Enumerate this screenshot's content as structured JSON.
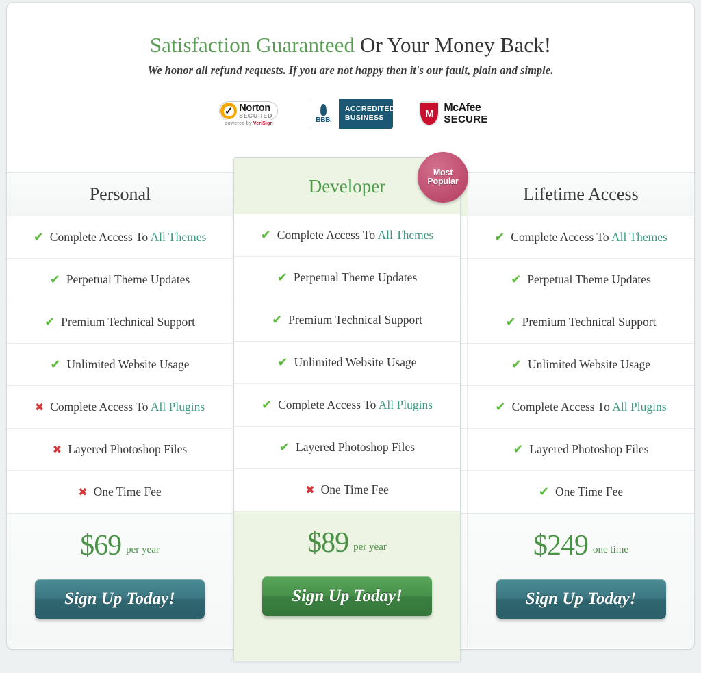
{
  "guarantee": {
    "headline_highlight": "Satisfaction Guaranteed",
    "headline_rest": " Or Your Money Back!",
    "subtext": "We honor all refund requests. If you are not happy then it's our fault, plain and simple."
  },
  "badges": {
    "norton": {
      "icon": "check-badge-icon",
      "line1": "Norton",
      "line2": "SECURED",
      "line3_pre": "powered by ",
      "line3_brand": "VeriSign"
    },
    "bbb": {
      "icon": "bbb-torch-icon",
      "mark": "BBB.",
      "line1": "ACCREDITED",
      "line2": "BUSINESS"
    },
    "mcafee": {
      "icon": "shield-icon",
      "shield_letter": "M",
      "line1": "McAfee",
      "line2": "SECURE"
    }
  },
  "ribbon": {
    "line1": "Most",
    "line2": "Popular"
  },
  "feature_labels": [
    {
      "text": "Complete Access To ",
      "link": "All Themes"
    },
    {
      "text": "Perpetual Theme Updates",
      "link": ""
    },
    {
      "text": "Premium Technical Support",
      "link": ""
    },
    {
      "text": "Unlimited Website Usage",
      "link": ""
    },
    {
      "text": "Complete Access To ",
      "link": "All Plugins"
    },
    {
      "text": "Layered Photoshop Files",
      "link": ""
    },
    {
      "text": "One Time Fee",
      "link": ""
    }
  ],
  "marks": {
    "yes": "✔",
    "no": "✖"
  },
  "colors": {
    "check_green": "#5cbb3c",
    "cross_red": "#d6383c",
    "link_teal": "#3f9a84",
    "price_green": "#4a9246",
    "featured_bg": "#edf4e4",
    "ribbon_pink": "#c25273",
    "cta_teal": "#3b7782",
    "cta_green": "#47914a"
  },
  "plans": [
    {
      "name": "Personal",
      "featured": false,
      "availability": [
        "yes",
        "yes",
        "yes",
        "yes",
        "no",
        "no",
        "no"
      ],
      "price": "$69",
      "period": "per year",
      "cta": "Sign Up Today!"
    },
    {
      "name": "Developer",
      "featured": true,
      "availability": [
        "yes",
        "yes",
        "yes",
        "yes",
        "yes",
        "yes",
        "no"
      ],
      "price": "$89",
      "period": "per year",
      "cta": "Sign Up Today!"
    },
    {
      "name": "Lifetime Access",
      "featured": false,
      "availability": [
        "yes",
        "yes",
        "yes",
        "yes",
        "yes",
        "yes",
        "yes"
      ],
      "price": "$249",
      "period": "one time",
      "cta": "Sign Up Today!"
    }
  ]
}
